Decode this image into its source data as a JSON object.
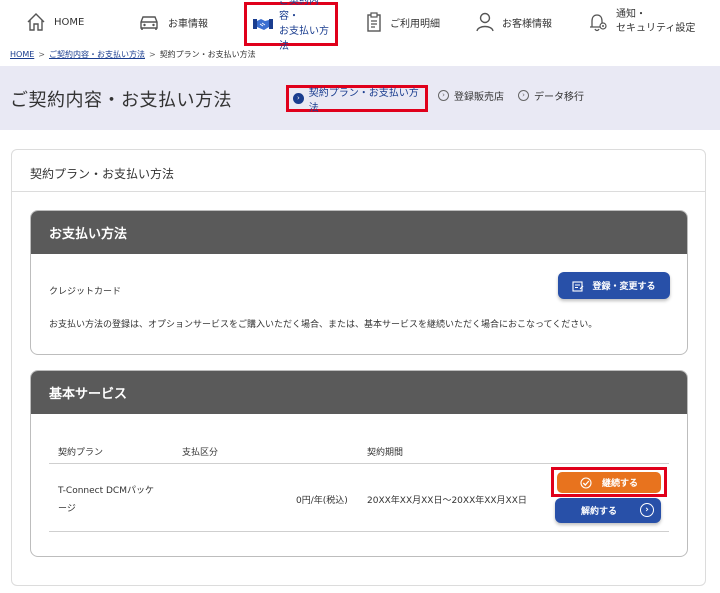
{
  "nav": {
    "home": "HOME",
    "car_info": "お車情報",
    "contract_line1": "ご契約内容・",
    "contract_line2": "お支払い方法",
    "usage": "ご利用明細",
    "customer": "お客様情報",
    "notify_line1": "通知・",
    "notify_line2": "セキュリティ設定"
  },
  "breadcrumb": {
    "home": "HOME",
    "contract": "ご契約内容・お支払い方法",
    "current": "契約プラン・お支払い方法",
    "separator": ">"
  },
  "header": {
    "title": "ご契約内容・お支払い方法",
    "subnav": {
      "plan": "契約プラン・お支払い方法",
      "dealer": "登録販売店",
      "migrate": "データ移行"
    }
  },
  "card": {
    "title": "契約プラン・お支払い方法"
  },
  "payment": {
    "heading": "お支払い方法",
    "method": "クレジットカード",
    "register_button": "登録・変更する",
    "note": "お支払い方法の登録は、オプションサービスをご購入いただく場合、または、基本サービスを継続いただく場合におこなってください。"
  },
  "service": {
    "heading": "基本サービス",
    "columns": [
      "契約プラン",
      "支払区分",
      "契約期間"
    ],
    "row": {
      "plan_line1": "T-Connect DCMパッケ",
      "plan_line2": "ージ",
      "price": "0円/年(税込)",
      "period": "20XX年XX月XX日～20XX年XX月XX日"
    },
    "continue_button": "継続する",
    "cancel_button": "解約する"
  },
  "colors": {
    "highlight": "#e0001b",
    "primary": "#2850a8",
    "accent_orange": "#e8731e",
    "panel_header": "#5a5a5a",
    "header_band": "#e9e9f4"
  }
}
